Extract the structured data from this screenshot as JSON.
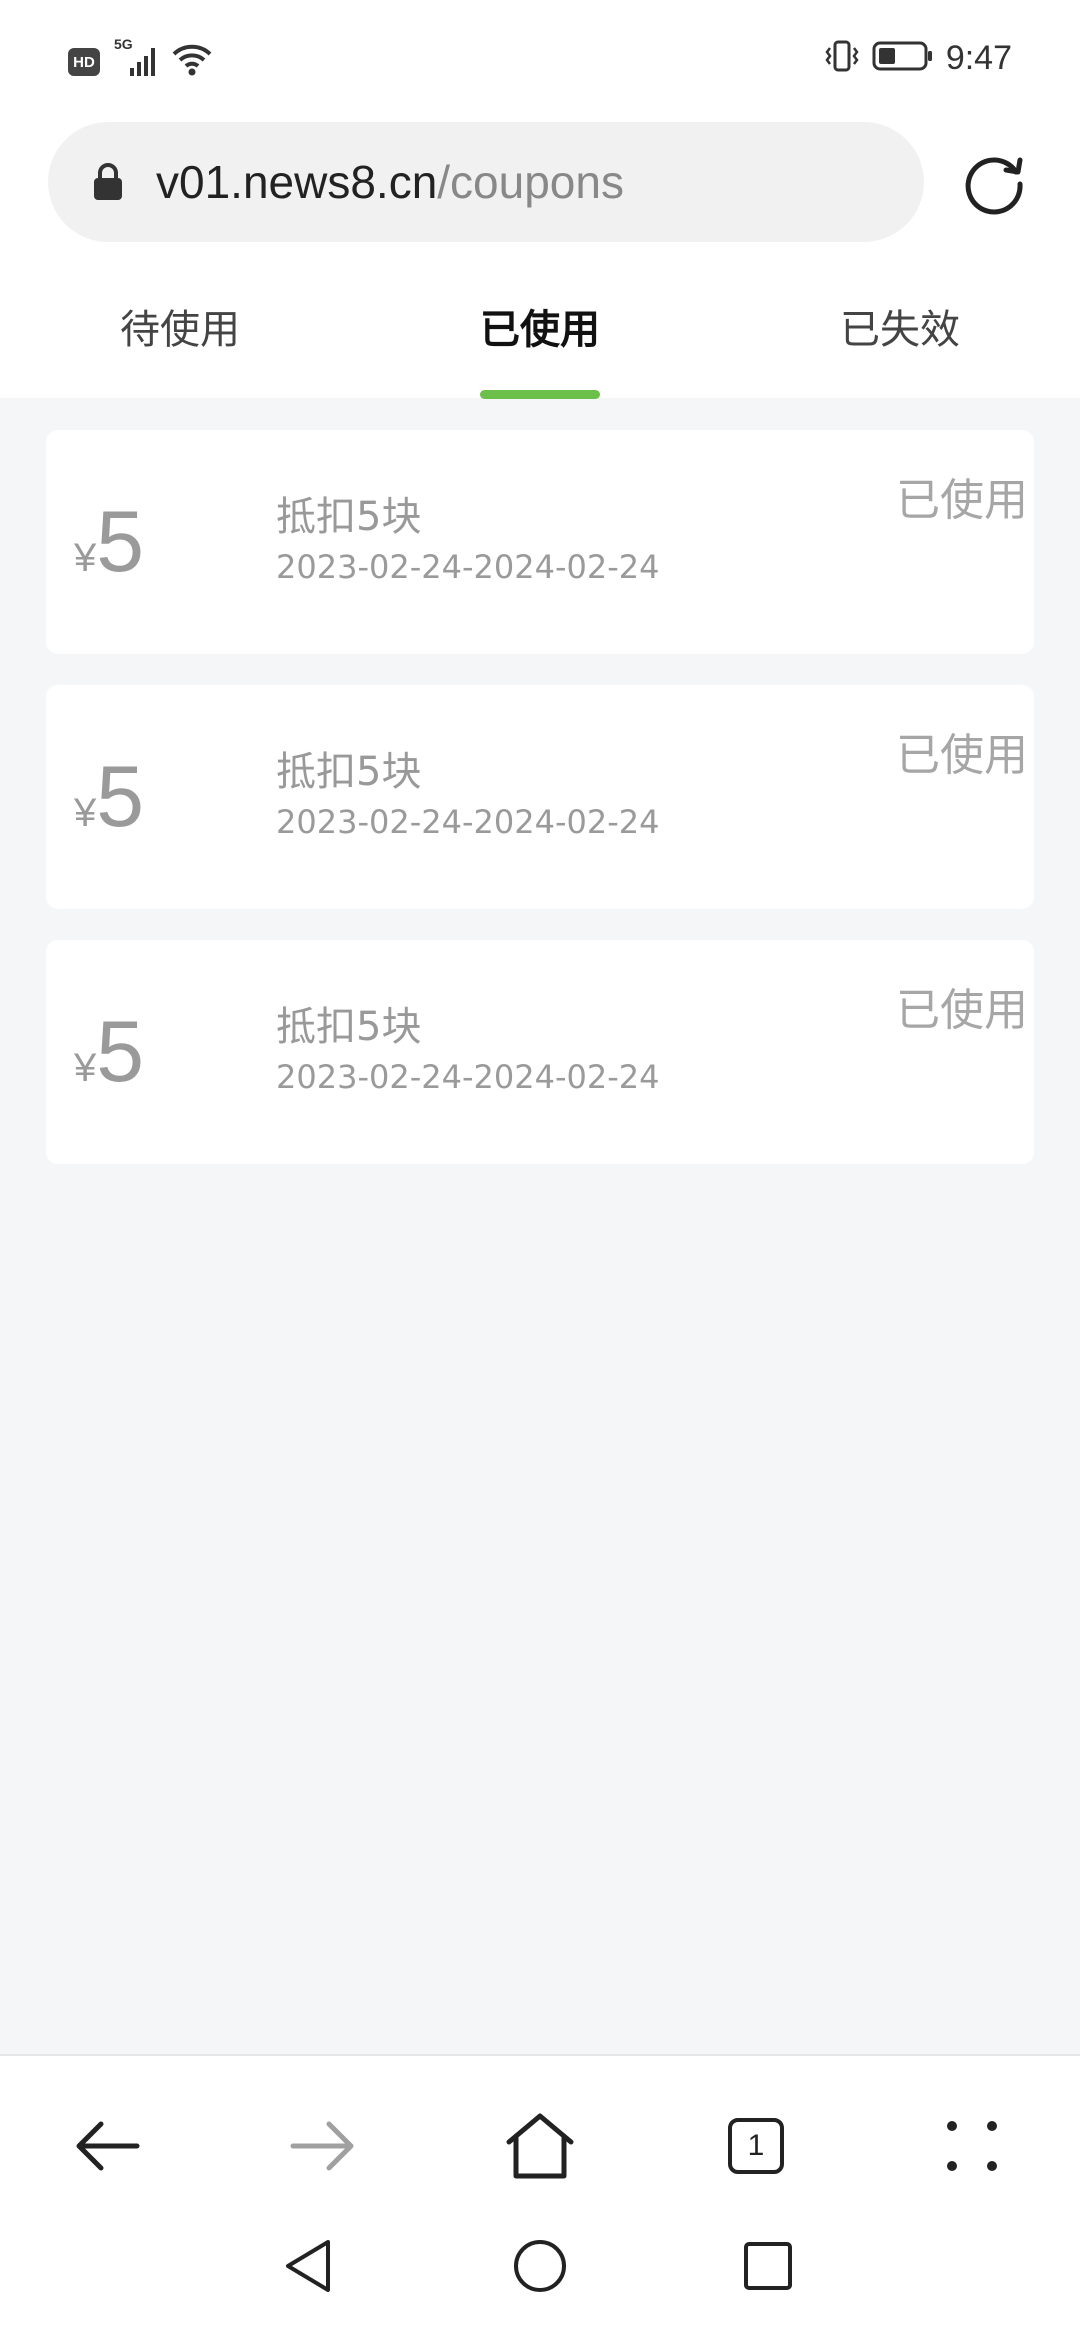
{
  "status_bar": {
    "hd_label": "HD",
    "network_label": "5G",
    "time": "9:47"
  },
  "url_bar": {
    "domain": "v01.news8.cn",
    "path": "/coupons"
  },
  "tabs": [
    {
      "label": "待使用",
      "active": false
    },
    {
      "label": "已使用",
      "active": true
    },
    {
      "label": "已失效",
      "active": false
    }
  ],
  "accent_color": "#6cc04a",
  "coupons": [
    {
      "currency": "¥",
      "amount": "5",
      "title": "抵扣5块",
      "date_range": "2023-02-24-2024-02-24",
      "status": "已使用"
    },
    {
      "currency": "¥",
      "amount": "5",
      "title": "抵扣5块",
      "date_range": "2023-02-24-2024-02-24",
      "status": "已使用"
    },
    {
      "currency": "¥",
      "amount": "5",
      "title": "抵扣5块",
      "date_range": "2023-02-24-2024-02-24",
      "status": "已使用"
    }
  ],
  "toolbar": {
    "tab_count": "1",
    "icons": [
      "back-arrow-icon",
      "forward-arrow-icon",
      "home-icon",
      "tabs-icon",
      "menu-dots-icon"
    ]
  },
  "system_nav": {
    "icons": [
      "nav-back-icon",
      "nav-home-icon",
      "nav-recents-icon"
    ]
  }
}
